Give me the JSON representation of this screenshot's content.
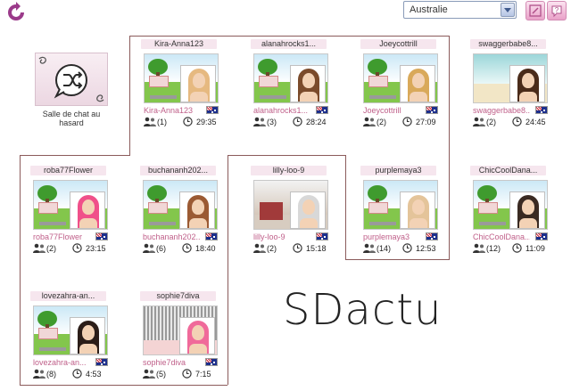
{
  "header": {
    "region_value": "Australie",
    "region_options": [
      "Australie"
    ]
  },
  "random_chat": {
    "label_line1": "Salle de chat au",
    "label_line2": "hasard"
  },
  "rooms": [
    {
      "name": "Kira-Anna123",
      "sub": "Kira-Anna123",
      "users": "(1)",
      "time": "29:35",
      "scene": "park",
      "hair": "#e6b980"
    },
    {
      "name": "alanahrocks1...",
      "sub": "alanahrocks1...",
      "users": "(3)",
      "time": "28:24",
      "scene": "park",
      "hair": "#7b4b2b"
    },
    {
      "name": "Joeycottrill",
      "sub": "Joeycottrill",
      "users": "(2)",
      "time": "27:09",
      "scene": "park",
      "hair": "#d9a95a"
    },
    {
      "name": "swaggerbabe8...",
      "sub": "swaggerbabe8...",
      "users": "(2)",
      "time": "24:45",
      "scene": "beach",
      "hair": "#4a2b1a"
    },
    {
      "name": "roba77Flower",
      "sub": "roba77Flower",
      "users": "(2)",
      "time": "23:15",
      "scene": "park",
      "hair": "#f0508a"
    },
    {
      "name": "buchananh202...",
      "sub": "buchananh202...",
      "users": "(6)",
      "time": "18:40",
      "scene": "park",
      "hair": "#9b5a33"
    },
    {
      "name": "lilly-loo-9",
      "sub": "lilly-loo-9",
      "users": "(2)",
      "time": "15:18",
      "scene": "room",
      "hair": "#d8d8d8"
    },
    {
      "name": "purplemaya3",
      "sub": "purplemaya3",
      "users": "(14)",
      "time": "12:53",
      "scene": "park",
      "hair": "#e4c49a"
    },
    {
      "name": "ChicCoolDana...",
      "sub": "ChicCoolDana...",
      "users": "(12)",
      "time": "11:09",
      "scene": "park",
      "hair": "#3a2a22"
    },
    {
      "name": "lovezahra-an...",
      "sub": "lovezahra-an...",
      "users": "(8)",
      "time": "4:53",
      "scene": "park",
      "hair": "#2b1d18"
    },
    {
      "name": "sophie7diva",
      "sub": "sophie7diva",
      "users": "(5)",
      "time": "7:15",
      "scene": "stripes",
      "hair": "#f06a9a"
    }
  ],
  "watermark": "SDactu",
  "colors": {
    "accent_pink": "#c0608a",
    "outline": "#8b5b5b",
    "card_name_bg": "#f6e6ee"
  }
}
